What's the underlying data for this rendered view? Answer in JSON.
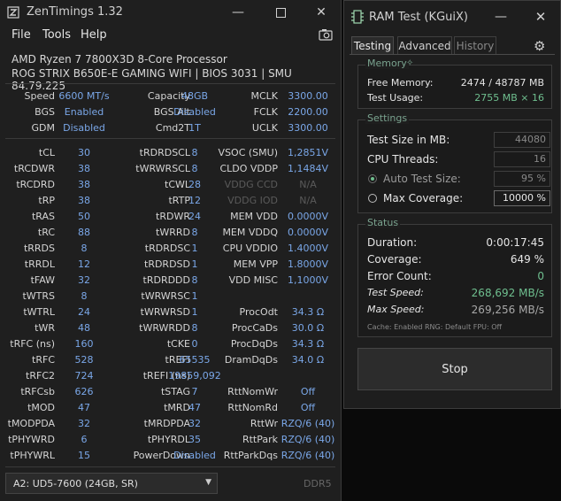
{
  "zentimings": {
    "title": "ZenTimings 1.32",
    "menu": [
      "File",
      "Tools",
      "Help"
    ],
    "cpu": "AMD Ryzen 7 7800X3D 8-Core Processor",
    "board": "ROG STRIX B650E-E GAMING WIFI | BIOS 3031 | SMU 84.79.225",
    "top_rows": [
      [
        "Speed",
        "6600 MT/s",
        "Capacity",
        "48GB",
        "MCLK",
        "3300.00"
      ],
      [
        "BGS",
        "Enabled",
        "BGS Alt",
        "Disabled",
        "FCLK",
        "2200.00"
      ],
      [
        "GDM",
        "Disabled",
        "Cmd2T",
        "1T",
        "UCLK",
        "3300.00"
      ]
    ],
    "timing_rows": [
      [
        "tCL",
        "30",
        "tRDRDSCL",
        "8",
        "VSOC (SMU)",
        "1,2851V"
      ],
      [
        "tRCDWR",
        "38",
        "tWRWRSCL",
        "8",
        "CLDO VDDP",
        "1,1484V"
      ],
      [
        "tRCDRD",
        "38",
        "tCWL",
        "28",
        "VDDG CCD",
        "N/A"
      ],
      [
        "tRP",
        "38",
        "tRTP",
        "12",
        "VDDG IOD",
        "N/A"
      ],
      [
        "tRAS",
        "50",
        "tRDWR",
        "24",
        "MEM VDD",
        "0.0000V"
      ],
      [
        "tRC",
        "88",
        "tWRRD",
        "8",
        "MEM VDDQ",
        "0.0000V"
      ],
      [
        "tRRDS",
        "8",
        "tRDRDSC",
        "1",
        "CPU VDDIO",
        "1.4000V"
      ],
      [
        "tRRDL",
        "12",
        "tRDRDSD",
        "1",
        "MEM VPP",
        "1.8000V"
      ],
      [
        "tFAW",
        "32",
        "tRDRDDD",
        "8",
        "VDD MISC",
        "1,1000V"
      ],
      [
        "tWTRS",
        "8",
        "tWRWRSC",
        "1",
        "",
        ""
      ],
      [
        "tWTRL",
        "24",
        "tWRWRSD",
        "1",
        "ProcOdt",
        "34.3 Ω"
      ],
      [
        "tWR",
        "48",
        "tWRWRDD",
        "8",
        "ProcCaDs",
        "30.0 Ω"
      ],
      [
        "tRFC (ns)",
        "160",
        "tCKE",
        "0",
        "ProcDqDs",
        "34.3 Ω"
      ],
      [
        "tRFC",
        "528",
        "tREFI",
        "65535",
        "DramDqDs",
        "34.0 Ω"
      ],
      [
        "tRFC2",
        "724",
        "tREFI (ns)",
        "19859,092",
        "",
        ""
      ],
      [
        "tRFCsb",
        "626",
        "tSTAG",
        "7",
        "RttNomWr",
        "Off"
      ],
      [
        "tMOD",
        "47",
        "tMRD",
        "47",
        "RttNomRd",
        "Off"
      ],
      [
        "tMODPDA",
        "32",
        "tMRDPDA",
        "32",
        "RttWr",
        "RZQ/6 (40)"
      ],
      [
        "tPHYWRD",
        "6",
        "tPHYRDL",
        "35",
        "RttPark",
        "RZQ/6 (40)"
      ],
      [
        "tPHYWRL",
        "15",
        "PowerDown",
        "Disabled",
        "RttParkDqs",
        "RZQ/6 (40)"
      ]
    ],
    "module_select": "A2: UD5-7600 (24GB, SR)",
    "ddr": "DDR5"
  },
  "ramtest": {
    "title": "RAM Test (KGuiX)",
    "tabs": [
      "Testing",
      "Advanced",
      "History"
    ],
    "memory": {
      "title": "Memory",
      "free_label": "Free Memory:",
      "free_value": "2474 / 48787 MB",
      "usage_label": "Test Usage:",
      "usage_value": "2755 MB × 16"
    },
    "settings": {
      "title": "Settings",
      "size_label": "Test Size in MB:",
      "size_value": "44080",
      "threads_label": "CPU Threads:",
      "threads_value": "16",
      "auto_label": "Auto Test Size:",
      "auto_value": "95 %",
      "cov_label": "Max Coverage:",
      "cov_value": "10000 %"
    },
    "status": {
      "title": "Status",
      "duration_label": "Duration:",
      "duration_value": "0:00:17:45",
      "coverage_label": "Coverage:",
      "coverage_value": "649 %",
      "errors_label": "Error Count:",
      "errors_value": "0",
      "speed_label": "Test Speed:",
      "speed_value": "268,692 MB/s",
      "max_label": "Max Speed:",
      "max_value": "269,256 MB/s",
      "footer": "Cache: Enabled  RNG: Default  FPU: Off"
    },
    "stop_label": "Stop"
  },
  "colors": {
    "value_blue": "#7aa7e8",
    "accent_green": "#6fbf8f",
    "dim": "#5a5a5a"
  }
}
